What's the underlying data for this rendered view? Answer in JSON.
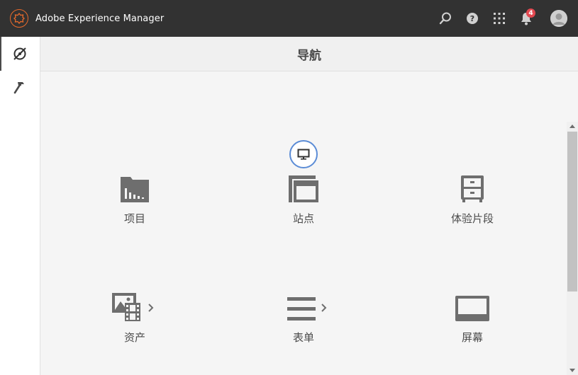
{
  "app": {
    "title": "Adobe Experience Manager",
    "brand_color": "#e86a2b"
  },
  "topbar": {
    "search_icon": "search-icon",
    "help_icon": "help-icon",
    "solutions_icon": "apps-grid-icon",
    "notifications_icon": "bell-icon",
    "notifications_count": "4",
    "avatar_icon": "user-avatar-icon"
  },
  "rail": {
    "items": [
      {
        "icon": "navigation-compass-icon",
        "active": true
      },
      {
        "icon": "hammer-tools-icon",
        "active": false
      }
    ]
  },
  "header": {
    "title": "导航"
  },
  "tiles": [
    {
      "label": "项目",
      "icon": "projects-folder-chart-icon",
      "has_submenu": false
    },
    {
      "label": "站点",
      "icon": "sites-windows-icon",
      "has_submenu": false,
      "badge_icon": "monitor-icon"
    },
    {
      "label": "体验片段",
      "icon": "experience-fragments-cabinet-icon",
      "has_submenu": false
    },
    {
      "label": "资产",
      "icon": "assets-image-film-icon",
      "has_submenu": true
    },
    {
      "label": "表单",
      "icon": "forms-lines-icon",
      "has_submenu": true
    },
    {
      "label": "屏幕",
      "icon": "screens-display-icon",
      "has_submenu": false
    }
  ],
  "colors": {
    "topbar_bg": "#323232",
    "icon_gray": "#6e6e6e",
    "text": "#4b4b4b",
    "badge_red": "#e34850",
    "focus_blue": "#5b8cd6"
  }
}
